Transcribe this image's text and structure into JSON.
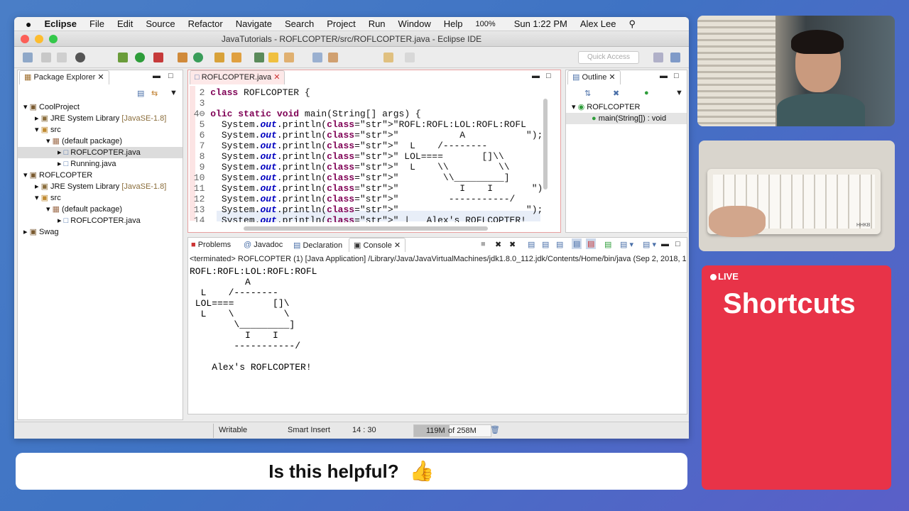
{
  "menubar": {
    "app": "Eclipse",
    "items": [
      "File",
      "Edit",
      "Source",
      "Refactor",
      "Navigate",
      "Search",
      "Project",
      "Run",
      "Window",
      "Help"
    ],
    "battery": "100%",
    "clock": "Sun 1:22 PM",
    "user": "Alex Lee"
  },
  "window": {
    "title": "JavaTutorials - ROFLCOPTER/src/ROFLCOPTER.java - Eclipse IDE"
  },
  "toolbar": {
    "quick_access_placeholder": "Quick Access"
  },
  "package_explorer": {
    "tab": "Package Explorer",
    "tree": [
      {
        "label": "CoolProject",
        "level": 0
      },
      {
        "label": "JRE System Library",
        "suffix": "[JavaSE-1.8]",
        "level": 1
      },
      {
        "label": "src",
        "level": 1
      },
      {
        "label": "(default package)",
        "level": 2
      },
      {
        "label": "ROFLCOPTER.java",
        "level": 3,
        "selected": true
      },
      {
        "label": "Running.java",
        "level": 3
      },
      {
        "label": "ROFLCOPTER",
        "level": 0
      },
      {
        "label": "JRE System Library",
        "suffix": "[JavaSE-1.8]",
        "level": 1
      },
      {
        "label": "src",
        "level": 1
      },
      {
        "label": "(default package)",
        "level": 2
      },
      {
        "label": "ROFLCOPTER.java",
        "level": 3
      },
      {
        "label": "Swag",
        "level": 0
      }
    ]
  },
  "editor": {
    "tab": "ROFLCOPTER.java",
    "lines": [
      {
        "n": "2",
        "t": "class ROFLCOPTER {"
      },
      {
        "n": "3",
        "t": ""
      },
      {
        "n": "4⊖",
        "t": "olic static void main(String[] args) {"
      },
      {
        "n": "5",
        "t": "  System.out.println(\"ROFL:ROFL:LOL:ROFL:ROFL"
      },
      {
        "n": "6",
        "t": "  System.out.println(\"           A           \");"
      },
      {
        "n": "7",
        "t": "  System.out.println(\"  L    /--------               \");"
      },
      {
        "n": "8",
        "t": "  System.out.println(\" LOL====       []\\\\              \");"
      },
      {
        "n": "9",
        "t": "  System.out.println(\"  L    \\\\         \\\\        \");"
      },
      {
        "n": "10",
        "t": "  System.out.println(\"        \\\\_________]                \")"
      },
      {
        "n": "11",
        "t": "  System.out.println(\"           I    I       \");"
      },
      {
        "n": "12",
        "t": "  System.out.println(\"         -----------/              \")"
      },
      {
        "n": "13",
        "t": "  System.out.println(\"                       \");"
      },
      {
        "n": "14",
        "t": "  System.out.println(\" |   Alex's ROFLCOPTER!"
      }
    ]
  },
  "outline": {
    "tab": "Outline",
    "class": "ROFLCOPTER",
    "method": "main(String[]) : void"
  },
  "bottom_tabs": [
    "Problems",
    "Javadoc",
    "Declaration",
    "Console"
  ],
  "console": {
    "header": "<terminated> ROFLCOPTER (1) [Java Application] /Library/Java/JavaVirtualMachines/jdk1.8.0_112.jdk/Contents/Home/bin/java (Sep 2, 2018, 1",
    "output": "ROFL:ROFL:LOL:ROFL:ROFL\n          A\n  L    /--------\n LOL====       []\\\n  L    \\         \\\n        \\_________]\n          I    I\n        -----------/\n\n    Alex's ROFLCOPTER!"
  },
  "status": {
    "mode": "Writable",
    "insert": "Smart Insert",
    "position": "14 : 30",
    "heap_used": "119M",
    "heap_total": "of 258M",
    "heap_fraction": 0.46
  },
  "overlay": {
    "live": "LIVE",
    "topic": "Shortcuts",
    "helpful": "Is this helpful?",
    "keyboard_label": "HHKB"
  },
  "colors": {
    "live_bg": "#e83348",
    "editor_highlight": "#fce4e4"
  }
}
